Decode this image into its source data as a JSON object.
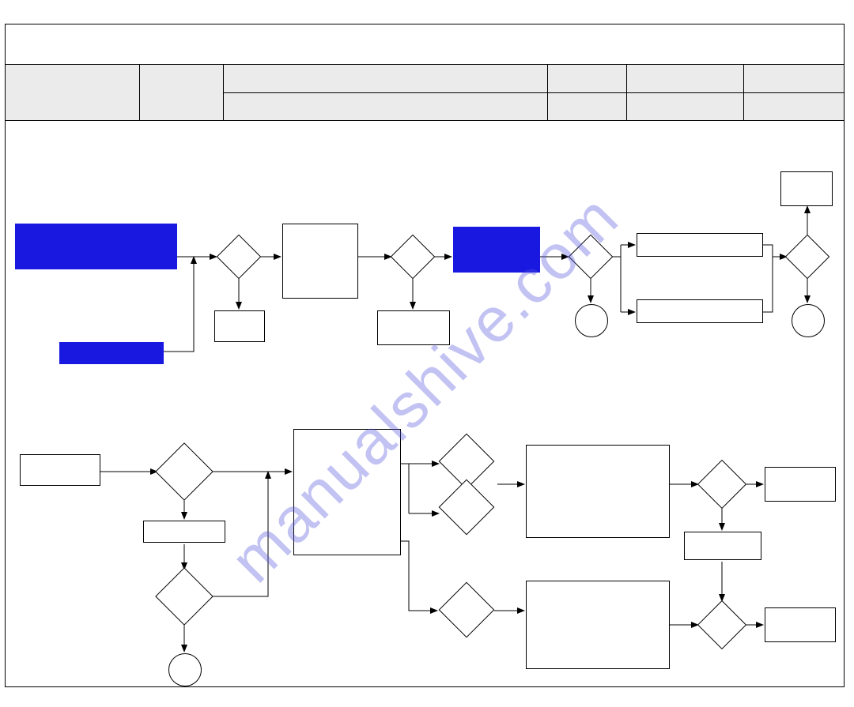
{
  "watermark": "manualshive.com",
  "header": {
    "cells": [
      "",
      "",
      "",
      "",
      "",
      ""
    ]
  },
  "diagram": {
    "description": "Two-lane horizontal flowchart with process boxes, decision diamonds, and terminator circles. Three blue-filled process boxes on the upper-left path.",
    "colors": {
      "blue_fill": "#1818e0"
    }
  }
}
